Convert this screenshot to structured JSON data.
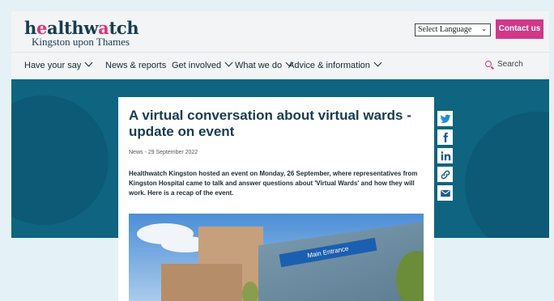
{
  "header": {
    "logo_main_prefix": "h",
    "logo_main_o": "e",
    "logo_main_rest": "althw",
    "logo_main_o2": "a",
    "logo_main_end": "tch",
    "logo_sub": "Kingston upon Thames",
    "language_select": "Select Language",
    "contact_label": "Contact us"
  },
  "nav": {
    "items": [
      {
        "label": "Have your say",
        "has_dropdown": true
      },
      {
        "label": "News & reports",
        "has_dropdown": false
      },
      {
        "label": "Get involved",
        "has_dropdown": true
      },
      {
        "label": "What we do",
        "has_dropdown": true
      },
      {
        "label": "Advice & information",
        "has_dropdown": true
      }
    ],
    "search_label": "Search"
  },
  "article": {
    "title": "A virtual conversation about virtual wards - update on event",
    "meta": "News - 29 September 2022",
    "summary": "Healthwatch Kingston hosted an event on Monday, 26 September, where representatives from Kingston Hospital came to talk and answer questions about 'Virtual Wards' and how they will work. Here is a recap of the event.",
    "image_sign": "Main Entrance"
  },
  "share": {
    "icons": [
      "twitter-icon",
      "facebook-icon",
      "linkedin-icon",
      "link-icon",
      "email-icon"
    ]
  },
  "colors": {
    "brand_pink": "#d0388a",
    "brand_navy": "#193c4f",
    "hero_teal": "#0f6480",
    "page_bg": "#e4f1f7"
  }
}
